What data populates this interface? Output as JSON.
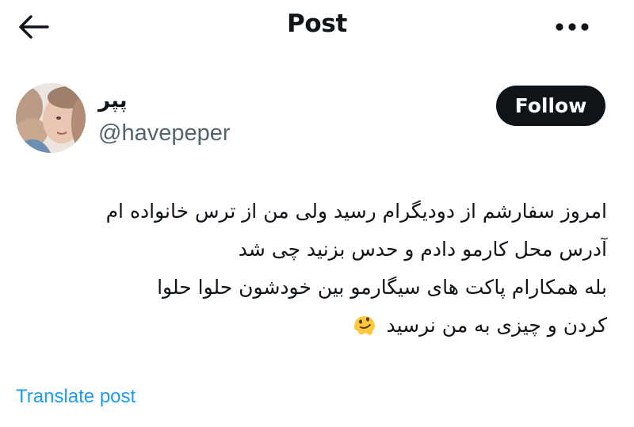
{
  "header": {
    "back_icon": "arrow-left-icon",
    "title": "Post",
    "more_icon": "ellipsis-horizontal-icon"
  },
  "author": {
    "display_name": "پپر",
    "handle": "@havepeper",
    "follow_label": "Follow"
  },
  "post": {
    "lines": [
      "امروز سفارشم از دودیگرام رسید ولی من از ترس خانواده ام",
      "آدرس محل کارمو دادم و حدس بزنید چی شد",
      "بله همکارام پاکت های سیگارمو بین خودشون حلوا حلوا",
      "کردن و چیزی به من نرسید"
    ],
    "emoji": "melting-face-emoji"
  },
  "footer": {
    "translate_label": "Translate post"
  },
  "colors": {
    "text": "#0f1419",
    "secondary": "#536471",
    "link": "#1d9bf0",
    "button_bg": "#0f1419"
  }
}
